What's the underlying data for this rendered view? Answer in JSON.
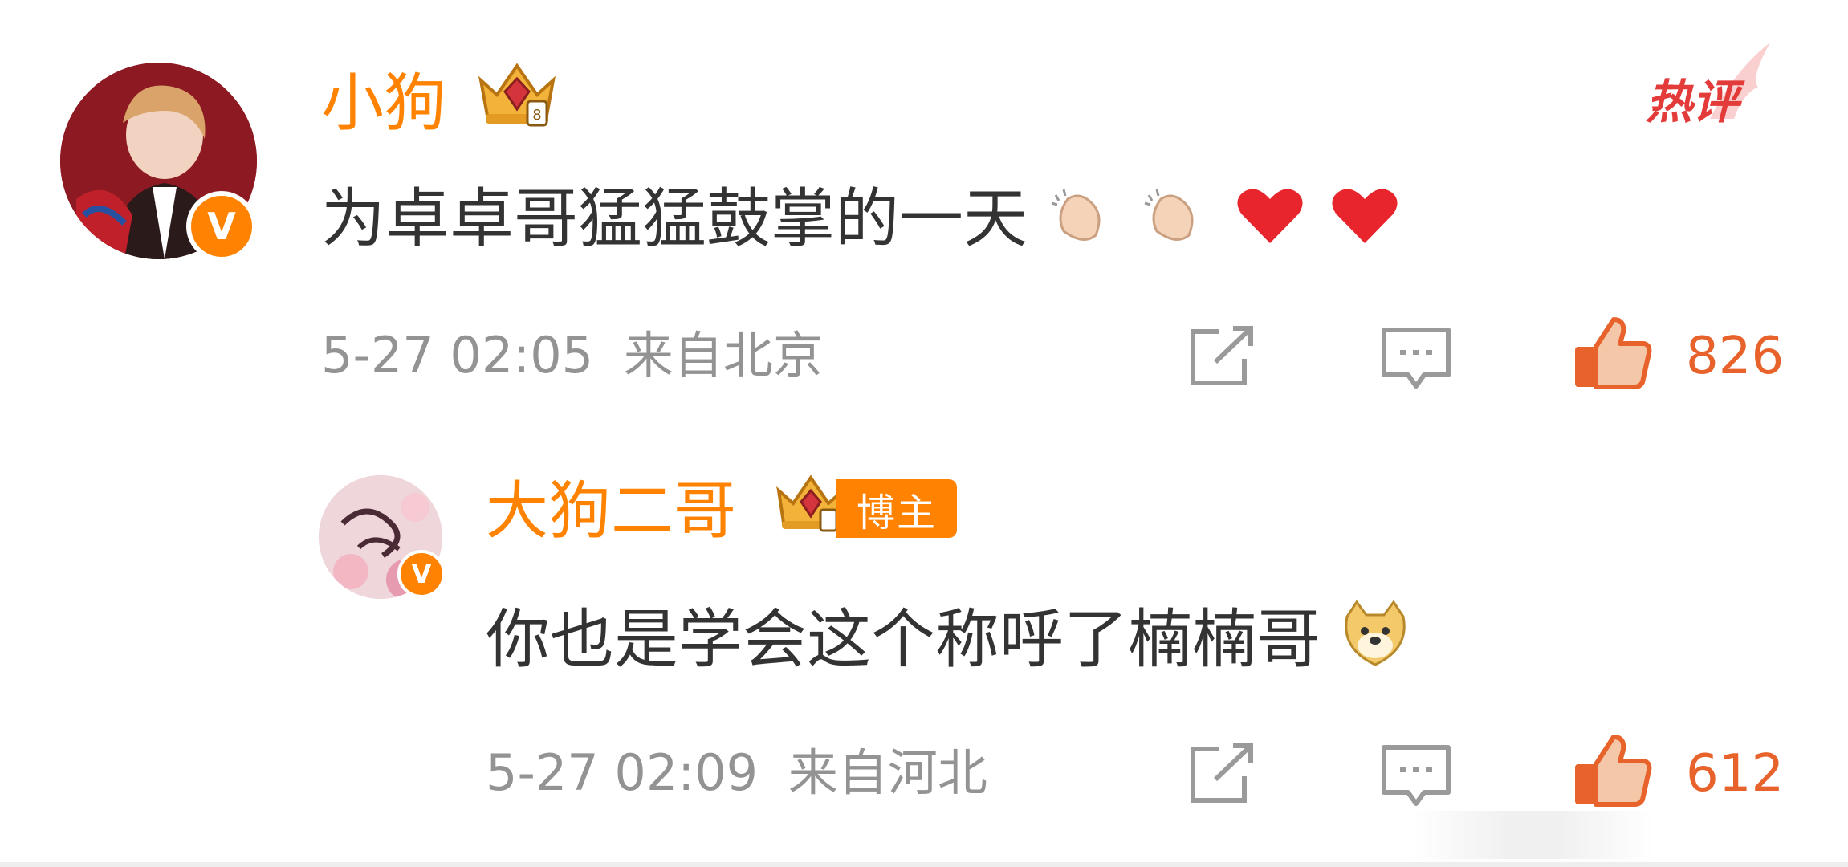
{
  "hot_label": "热评",
  "comments": [
    {
      "username": "小狗",
      "text": "为卓卓哥猛猛鼓掌的一天",
      "emojis": [
        "clapping-hands",
        "clapping-hands",
        "red-heart",
        "red-heart"
      ],
      "time": "5-27 02:05",
      "location": "来自北京",
      "likes": "826",
      "verified": true
    },
    {
      "username": "大狗二哥",
      "badge": "博主",
      "text": "你也是学会这个称呼了楠楠哥",
      "emojis": [
        "doge-face"
      ],
      "time": "5-27 02:09",
      "location": "来自河北",
      "likes": "612",
      "verified": true
    }
  ],
  "verified_glyph": "V",
  "colors": {
    "accent": "#ff8200",
    "like": "#e8632b",
    "hot": "#e33a3a",
    "meta": "#939393",
    "text": "#333333"
  }
}
